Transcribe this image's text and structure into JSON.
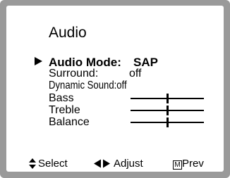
{
  "menu": {
    "title": "Audio",
    "items": [
      {
        "label": "Audio Mode:",
        "value": "SAP",
        "selected": true
      },
      {
        "label": "Surround:",
        "value": "off"
      },
      {
        "label": "Dynamic Sound:",
        "value": "off"
      },
      {
        "label": "Bass",
        "level": 0.5
      },
      {
        "label": "Treble",
        "level": 0.5
      },
      {
        "label": "Balance",
        "level": 0.5
      }
    ]
  },
  "footer": {
    "select_label": "Select",
    "adjust_label": "Adjust",
    "prev_label": "Prev",
    "prev_key": "M"
  },
  "icons": {
    "selection": "triangle-right-icon",
    "select_hint": "up-down-arrow-icon",
    "adjust_hint": "left-right-arrow-icon",
    "prev_key": "menu-key-icon"
  },
  "colors": {
    "frame": "#9a9a9a",
    "panel": "#ffffff",
    "text": "#000000"
  }
}
